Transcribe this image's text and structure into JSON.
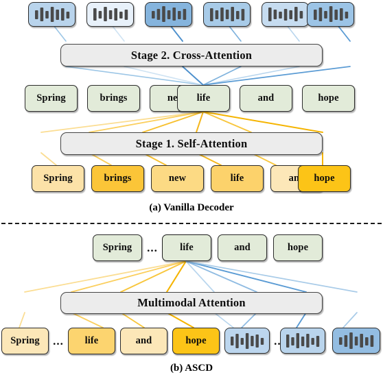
{
  "figure": {
    "panels": [
      {
        "id": "panel-a",
        "caption": "(a) Vanilla Decoder",
        "stages": [
          {
            "id": "stage2",
            "label": "Stage 2. Cross-Attention"
          },
          {
            "id": "stage1",
            "label": "Stage 1. Self-Attention"
          }
        ],
        "audio_row": {
          "id": "panel-a-audio-row",
          "ellipsis": "...",
          "tokens": [
            {
              "name": "audio-token-1",
              "fill": "#b9d4ec",
              "bars": [
                0.52,
                0.8,
                0.44,
                0.86,
                0.62,
                0.7,
                0.4
              ]
            },
            {
              "name": "audio-token-2",
              "fill": "#e8f1fa",
              "bars": [
                0.7,
                0.48,
                0.84,
                0.56,
                0.76,
                0.46,
                0.64
              ]
            },
            {
              "name": "audio-token-3",
              "fill": "#85b4dd",
              "bars": [
                0.46,
                0.62,
                0.88,
                0.56,
                0.78,
                0.5,
                0.7
              ]
            },
            {
              "name": "audio-token-4",
              "fill": "#a8cbe8",
              "bars": [
                0.78,
                0.56,
                0.84,
                0.6,
                0.88,
                0.52,
                0.74
              ]
            },
            {
              "name": "audio-token-5",
              "fill": "#c6dcf0",
              "bars": [
                0.82,
                0.58,
                0.46,
                0.72,
                0.54,
                0.86,
                0.5
              ]
            },
            {
              "name": "audio-token-6",
              "fill": "#9cc4e6",
              "bars": [
                0.6,
                0.84,
                0.5,
                0.88,
                0.58,
                0.76,
                0.44
              ]
            }
          ]
        },
        "green_row": {
          "id": "panel-a-green-row",
          "tokens": [
            {
              "name": "green-token-spring",
              "label": "Spring",
              "fill": "#e2ebd9"
            },
            {
              "name": "green-token-brings",
              "label": "brings",
              "fill": "#e2ebd9"
            },
            {
              "name": "green-token-new",
              "label": "new",
              "fill": "#e2ebd9"
            },
            {
              "name": "green-token-life",
              "label": "life",
              "fill": "#e2ebd9"
            },
            {
              "name": "green-token-and",
              "label": "and",
              "fill": "#e2ebd9"
            },
            {
              "name": "green-token-hope",
              "label": "hope",
              "fill": "#e2ebd9"
            }
          ]
        },
        "yellow_row": {
          "id": "panel-a-yellow-row",
          "tokens": [
            {
              "name": "yellow-token-spring",
              "label": "Spring",
              "fill": "#fce2a8"
            },
            {
              "name": "yellow-token-brings",
              "label": "brings",
              "fill": "#fbc538"
            },
            {
              "name": "yellow-token-new",
              "label": "new",
              "fill": "#fdd濃"
            },
            {
              "name": "yellow-token-life",
              "label": "life",
              "fill": "#fcd26b"
            },
            {
              "name": "yellow-token-and",
              "label": "and",
              "fill": "#fce7b8"
            },
            {
              "name": "yellow-token-hope",
              "label": "hope",
              "fill": "#fcc417"
            }
          ]
        }
      },
      {
        "id": "panel-b",
        "caption": "(b) ASCD",
        "stages": [
          {
            "id": "multimodal",
            "label": "Multimodal Attention"
          }
        ],
        "green_row": {
          "id": "panel-b-green-row",
          "ellipsis": "...",
          "tokens": [
            {
              "name": "green-token-spring",
              "label": "Spring",
              "fill": "#e2ebd9"
            },
            {
              "name": "green-token-life",
              "label": "life",
              "fill": "#e2ebd9"
            },
            {
              "name": "green-token-and",
              "label": "and",
              "fill": "#e2ebd9"
            },
            {
              "name": "green-token-hope",
              "label": "hope",
              "fill": "#e2ebd9"
            }
          ]
        },
        "bottom_row": {
          "id": "panel-b-bottom-row",
          "ellipsis_text": "...",
          "ellipsis_audio": "...",
          "text_tokens": [
            {
              "name": "yellow-token-spring",
              "label": "Spring",
              "fill": "#fce7b8"
            },
            {
              "name": "yellow-token-life",
              "label": "life",
              "fill": "#fcd46f"
            },
            {
              "name": "yellow-token-and",
              "label": "and",
              "fill": "#fce7b8"
            },
            {
              "name": "yellow-token-hope",
              "label": "hope",
              "fill": "#fcc417"
            }
          ],
          "audio_tokens": [
            {
              "name": "audio-token-1",
              "fill": "#bcd6ee",
              "bars": [
                0.54,
                0.82,
                0.46,
                0.88,
                0.62,
                0.74,
                0.44
              ]
            },
            {
              "name": "audio-token-2",
              "fill": "#b9d4ec",
              "bars": [
                0.72,
                0.5,
                0.86,
                0.58,
                0.78,
                0.48,
                0.66
              ]
            },
            {
              "name": "audio-token-3",
              "fill": "#93bde2",
              "bars": [
                0.48,
                0.64,
                0.9,
                0.56,
                0.8,
                0.52,
                0.72
              ]
            }
          ]
        }
      }
    ],
    "colors": {
      "blue_line": "#5a9bd4",
      "yellow_line": "#f5b92a",
      "green_fill": "#e2ebd9",
      "attention_fill": "#ececec",
      "border": "#2b2b2b"
    }
  }
}
